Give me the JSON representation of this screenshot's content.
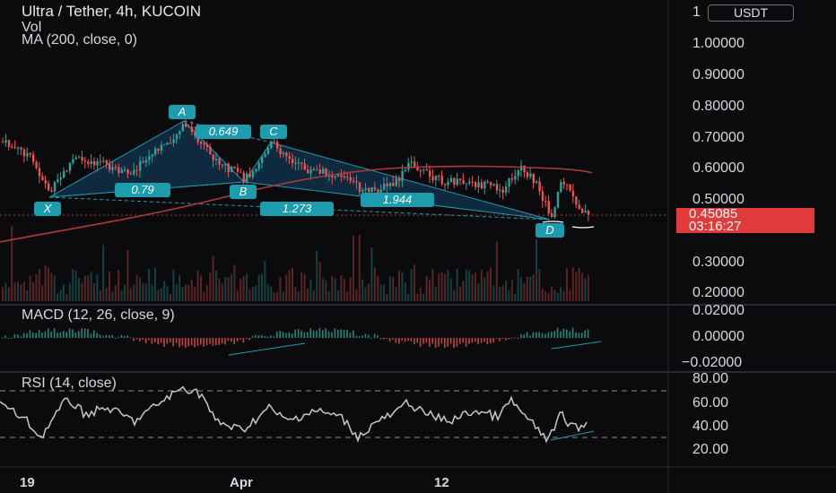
{
  "header": {
    "title": "Ultra / Tether, 4h, KUCOIN",
    "indicators": [
      "Vol",
      "MA (200, close, 0)"
    ]
  },
  "currency_button": "USDT",
  "price_axis": {
    "labels": [
      "1",
      "1.00000",
      "0.90000",
      "0.80000",
      "0.70000",
      "0.60000",
      "0.50000",
      "0.30000",
      "0.20000"
    ]
  },
  "current_price": {
    "price": "0.45085",
    "countdown": "03:16:27"
  },
  "pattern_labels": {
    "points": [
      "X",
      "A",
      "B",
      "C",
      "D"
    ],
    "ratios": [
      "0.649",
      "0.79",
      "1.273",
      "1.944"
    ]
  },
  "macd": {
    "title": "MACD (12, 26, close, 9)",
    "axis": [
      "0.02000",
      "0.00000",
      "−0.02000"
    ]
  },
  "rsi": {
    "title": "RSI (14, close)",
    "axis": [
      "80.00",
      "60.00",
      "40.00",
      "20.00"
    ]
  },
  "time_axis": [
    "19",
    "Apr",
    "12"
  ],
  "colors": {
    "background": "#0b0b0e",
    "up": "#26a69a",
    "down": "#ef5350",
    "pattern": "#1c9cad",
    "ma": "#b03a3a",
    "price_tag": "#e03a3a"
  }
}
